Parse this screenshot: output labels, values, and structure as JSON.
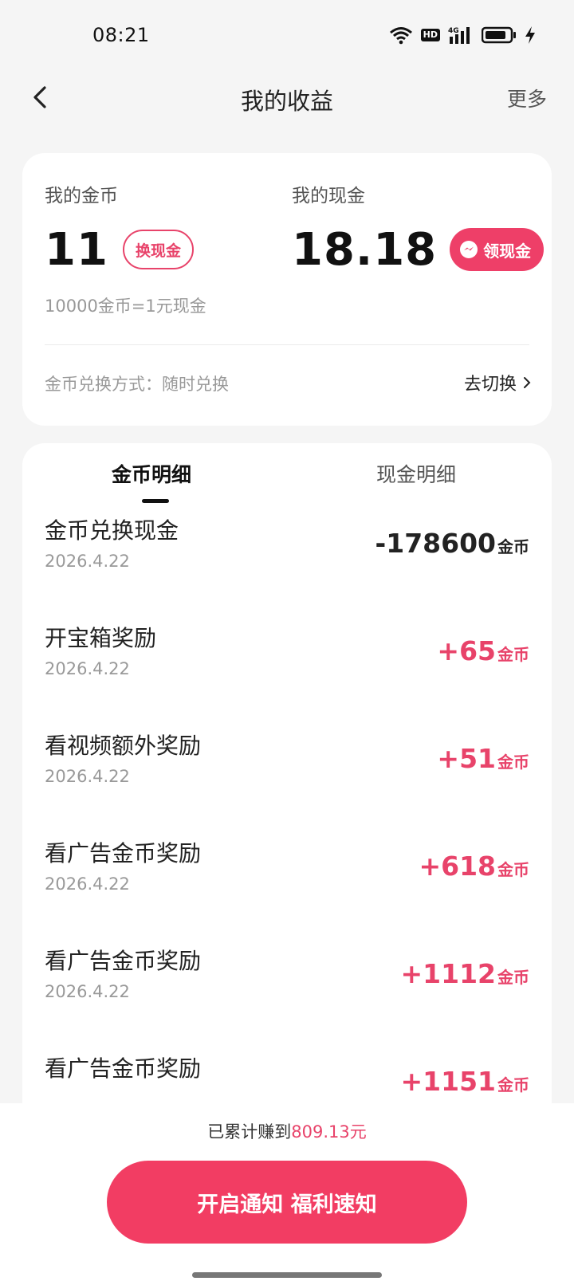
{
  "status_bar": {
    "time": "08:21",
    "icons": [
      "wifi-icon",
      "hd-icon",
      "signal-4g-icon",
      "battery-icon",
      "charging-icon"
    ],
    "hd_label": "HD",
    "network_label": "4G"
  },
  "nav": {
    "title": "我的收益",
    "more_label": "更多",
    "back_icon": "chevron-left-icon"
  },
  "summary": {
    "coins_label": "我的金币",
    "coins_value": "11",
    "exchange_button": "换现金",
    "cash_label": "我的现金",
    "cash_value": "18.18",
    "withdraw_button": "领现金",
    "rate_text": "10000金币=1元现金",
    "method_text": "金币兑换方式：随时兑换",
    "switch_label": "去切换"
  },
  "tabs": [
    {
      "label": "金币明细",
      "active": true
    },
    {
      "label": "现金明细",
      "active": false
    }
  ],
  "records": [
    {
      "title": "金币兑换现金",
      "date": "2026.4.22",
      "amount": "-178600",
      "unit": "金币",
      "type": "negative"
    },
    {
      "title": "开宝箱奖励",
      "date": "2026.4.22",
      "amount": "+65",
      "unit": "金币",
      "type": "positive"
    },
    {
      "title": "看视频额外奖励",
      "date": "2026.4.22",
      "amount": "+51",
      "unit": "金币",
      "type": "positive"
    },
    {
      "title": "看广告金币奖励",
      "date": "2026.4.22",
      "amount": "+618",
      "unit": "金币",
      "type": "positive"
    },
    {
      "title": "看广告金币奖励",
      "date": "2026.4.22",
      "amount": "+1112",
      "unit": "金币",
      "type": "positive"
    },
    {
      "title": "看广告金币奖励",
      "date": "",
      "amount": "+1151",
      "unit": "金币",
      "type": "positive"
    }
  ],
  "footer": {
    "total_prefix": "已累计赚到",
    "total_amount": "809.13元",
    "cta_label": "开启通知 福利速知"
  },
  "colors": {
    "accent": "#ee3f68",
    "positive": "#e8436a",
    "negative": "#222222",
    "background": "#f5f5f5"
  }
}
